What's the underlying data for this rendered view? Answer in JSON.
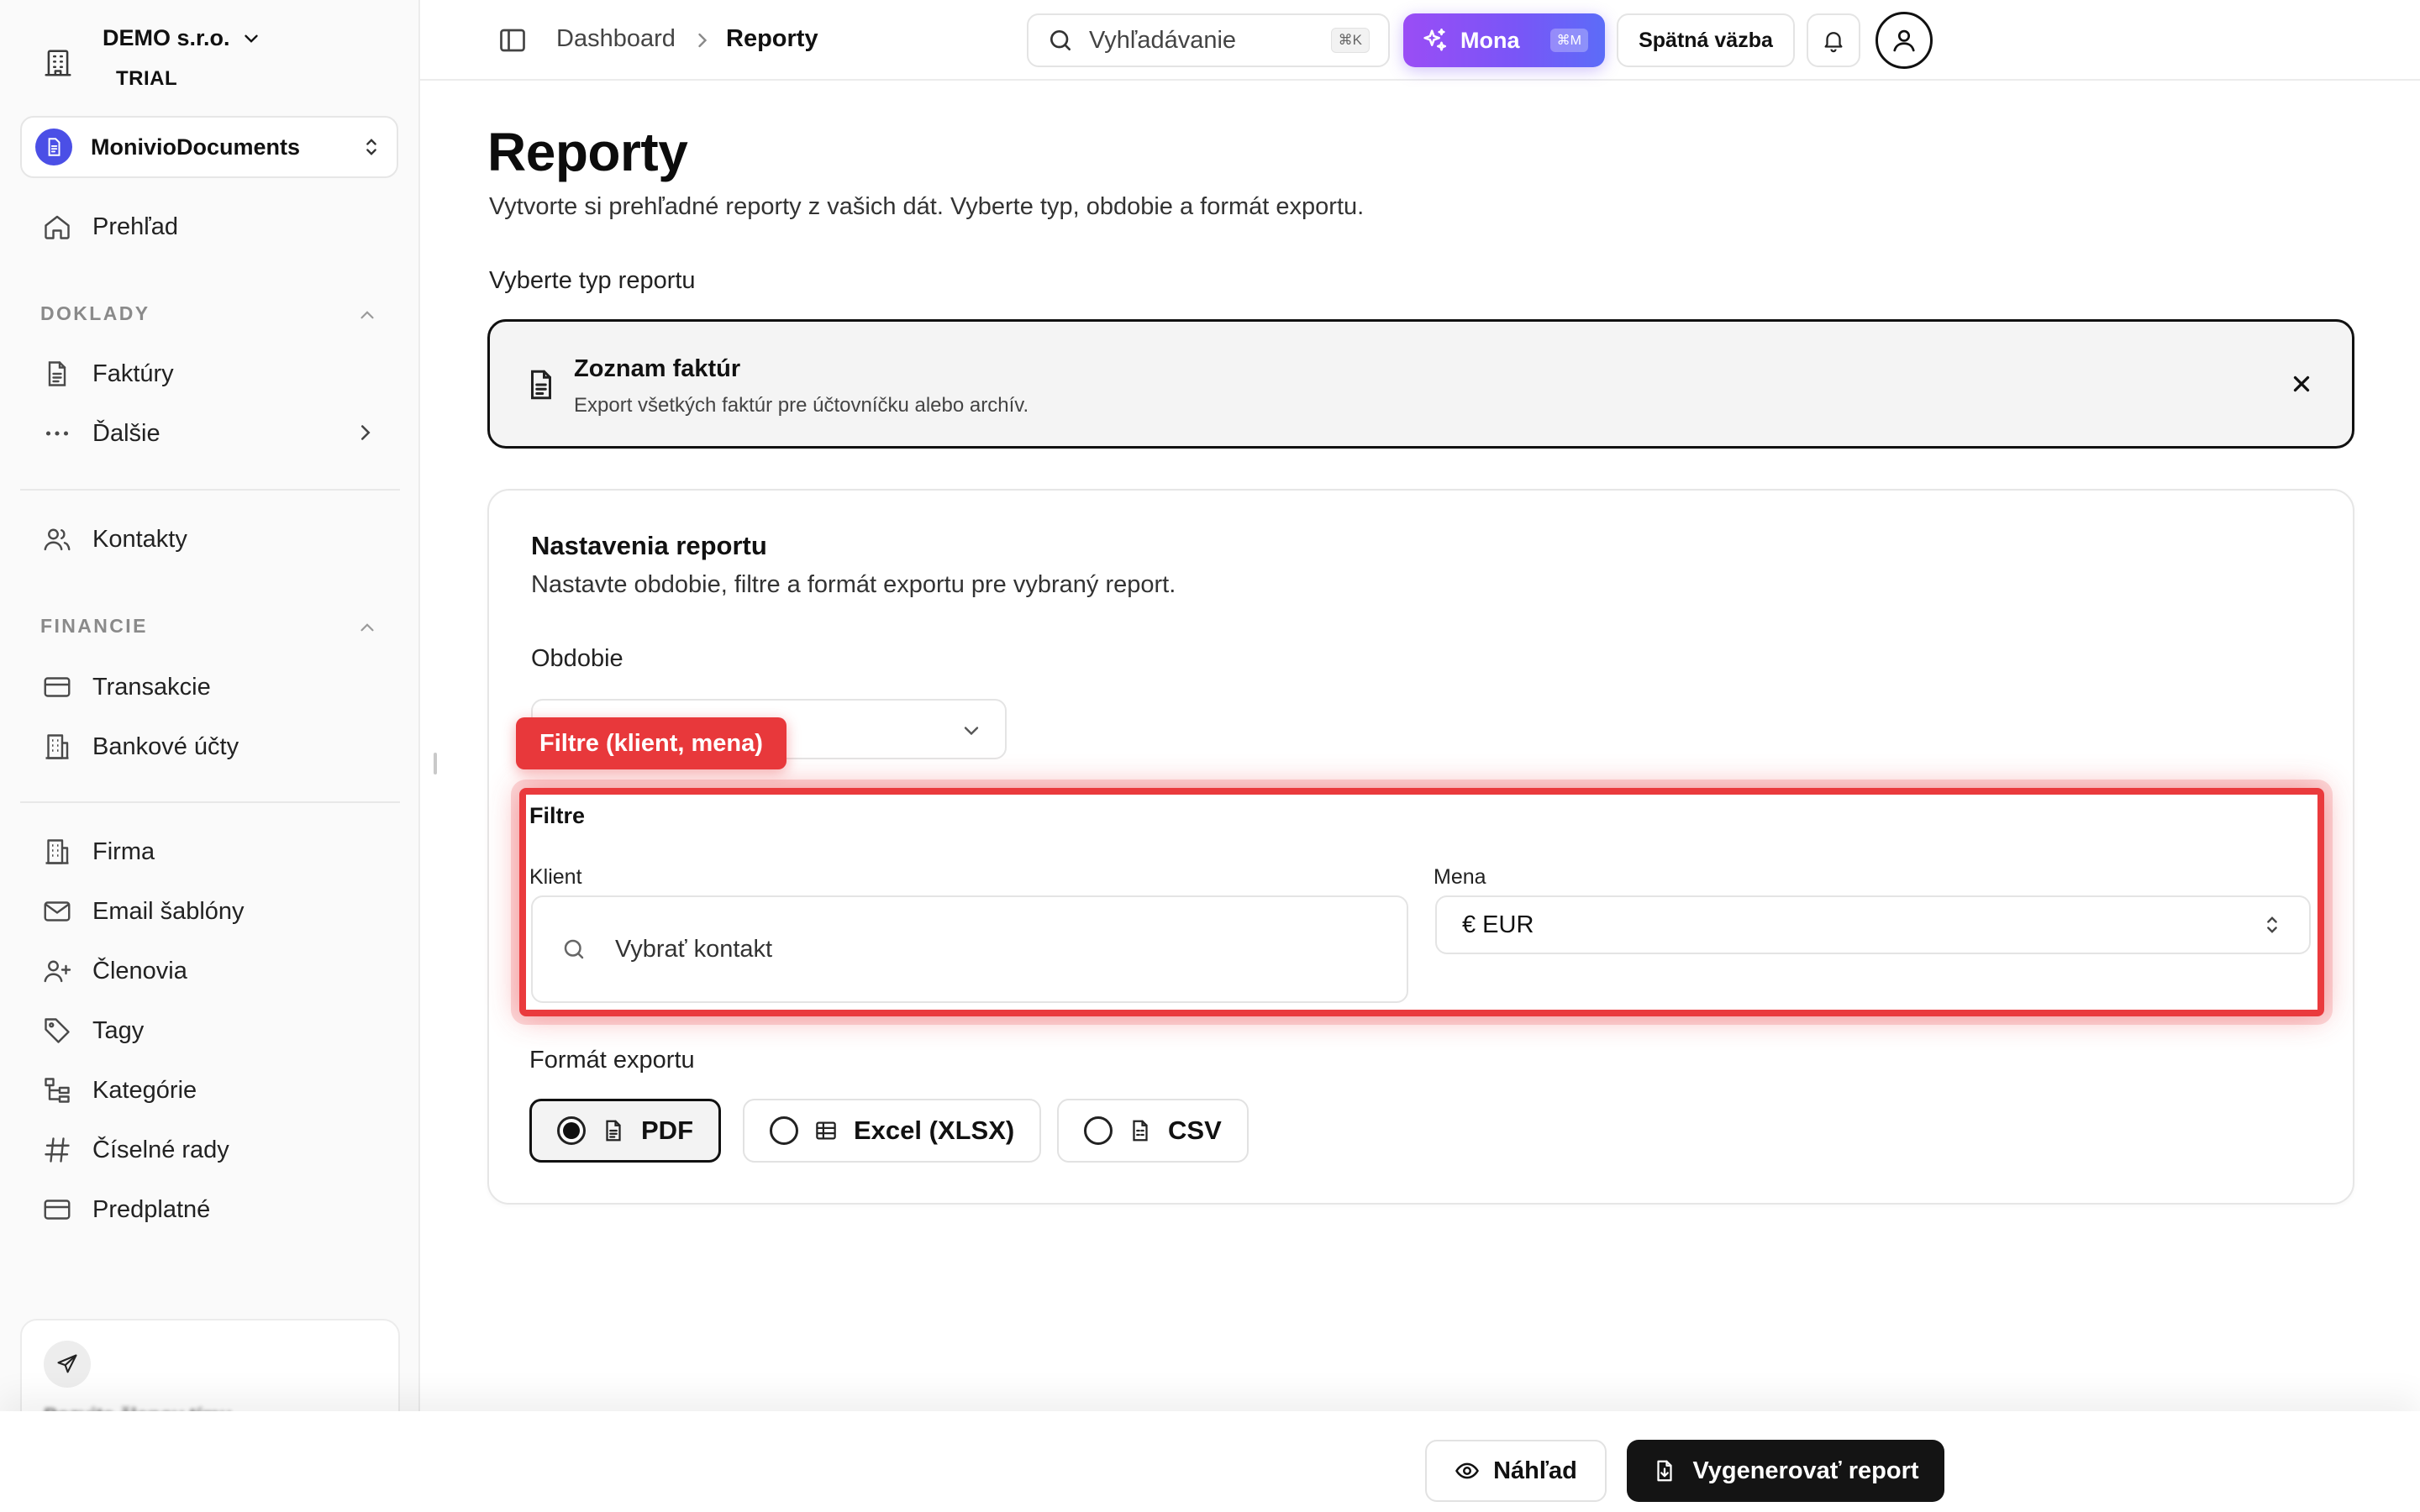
{
  "org": {
    "name": "DEMO s.r.o.",
    "plan": "TRIAL"
  },
  "workspace": {
    "name": "MonivioDocuments"
  },
  "sidebar": {
    "overview": "Prehľad",
    "sections": {
      "documents": "DOKLADY",
      "finance": "FINANCIE"
    },
    "items": {
      "invoices": "Faktúry",
      "more": "Ďalšie",
      "contacts": "Kontakty",
      "transactions": "Transakcie",
      "bank_accounts": "Bankové účty",
      "company": "Firma",
      "email_templates": "Email šablóny",
      "members": "Členovia",
      "tags": "Tagy",
      "categories": "Kategórie",
      "number_series": "Číselné rady",
      "subscription": "Predplatné"
    },
    "help_text": "Pozvite členov tímu"
  },
  "topbar": {
    "breadcrumb": [
      "Dashboard",
      "Reporty"
    ],
    "search_placeholder": "Vyhľadávanie",
    "search_shortcut": "⌘K",
    "assistant_label": "Mona",
    "assistant_shortcut": "⌘M",
    "feedback_label": "Spätná väzba"
  },
  "page": {
    "title": "Reporty",
    "subtitle": "Vytvorte si prehľadné reporty z vašich dát. Vyberte typ, obdobie a formát exportu.",
    "type_label": "Vyberte typ reportu",
    "selected_type": {
      "name": "Zoznam faktúr",
      "description": "Export všetkých faktúr pre účtovníčku alebo archív."
    }
  },
  "settings": {
    "title": "Nastavenia reportu",
    "subtitle": "Nastavte obdobie, filtre a formát exportu pre vybraný report.",
    "period_label": "Obdobie",
    "period_value": "",
    "filters_label": "Filtre",
    "client_label": "Klient",
    "client_placeholder": "Vybrať kontakt",
    "currency_label": "Mena",
    "currency_value": "€ EUR",
    "format_label": "Formát exportu",
    "formats": [
      {
        "label": "PDF",
        "selected": true
      },
      {
        "label": "Excel (XLSX)",
        "selected": false
      },
      {
        "label": "CSV",
        "selected": false
      }
    ]
  },
  "highlight": {
    "label": "Filtre (klient, mena)",
    "color": "#ea3a3d"
  },
  "actions": {
    "preview": "Náhľad",
    "generate": "Vygenerovať report"
  },
  "colors": {
    "accent_purple": "#7a55f7",
    "workspace_blue": "#4b4fe6",
    "primary_dark": "#141414"
  }
}
